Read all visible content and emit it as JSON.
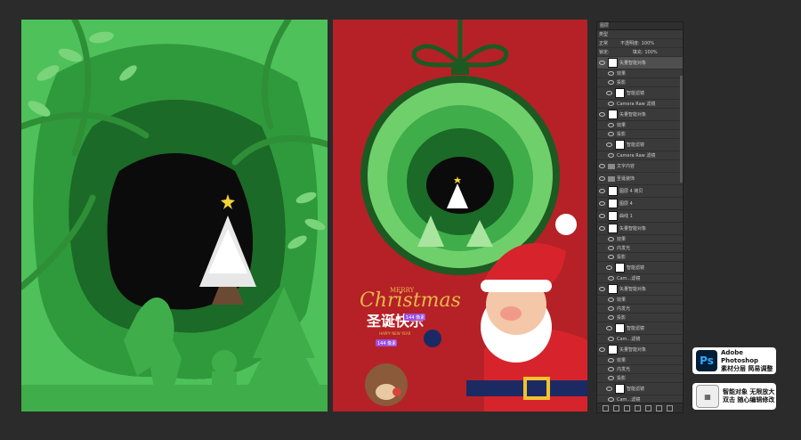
{
  "layers_panel": {
    "tab_label": "图层",
    "filter_kind": "类型",
    "blend_mode": "正常",
    "opacity_label": "不透明度:",
    "opacity_value": "100%",
    "lock_label": "锁定:",
    "fill_label": "填充:",
    "fill_value": "100%",
    "layers": [
      {
        "name": "矢量智能对象",
        "type": "layer",
        "selected": true
      },
      {
        "name": "效果",
        "type": "sub"
      },
      {
        "name": "投影",
        "type": "sub"
      },
      {
        "name": "智能滤镜",
        "type": "filter"
      },
      {
        "name": "Camera Raw 滤镜",
        "type": "sub"
      },
      {
        "name": "矢量智能对象",
        "type": "layer"
      },
      {
        "name": "效果",
        "type": "sub"
      },
      {
        "name": "投影",
        "type": "sub"
      },
      {
        "name": "智能滤镜",
        "type": "filter"
      },
      {
        "name": "Camera Raw 滤镜",
        "type": "sub"
      },
      {
        "name": "文字内容",
        "type": "group"
      },
      {
        "name": "圣诞装饰",
        "type": "group"
      },
      {
        "name": "图层 4 拷贝",
        "type": "layer"
      },
      {
        "name": "图层 4",
        "type": "layer"
      },
      {
        "name": "曲线 1",
        "type": "layer"
      },
      {
        "name": "矢量智能对象",
        "type": "layer"
      },
      {
        "name": "效果",
        "type": "sub"
      },
      {
        "name": "内发光",
        "type": "sub"
      },
      {
        "name": "投影",
        "type": "sub"
      },
      {
        "name": "智能滤镜",
        "type": "filter"
      },
      {
        "name": "Cam...滤镜",
        "type": "sub"
      },
      {
        "name": "矢量智能对象",
        "type": "layer"
      },
      {
        "name": "效果",
        "type": "sub"
      },
      {
        "name": "内发光",
        "type": "sub"
      },
      {
        "name": "投影",
        "type": "sub"
      },
      {
        "name": "智能滤镜",
        "type": "filter"
      },
      {
        "name": "Cam...滤镜",
        "type": "sub"
      },
      {
        "name": "矢量智能对象",
        "type": "layer"
      },
      {
        "name": "效果",
        "type": "sub"
      },
      {
        "name": "内发光",
        "type": "sub"
      },
      {
        "name": "投影",
        "type": "sub"
      },
      {
        "name": "智能滤镜",
        "type": "filter"
      },
      {
        "name": "Cam...滤镜",
        "type": "sub"
      }
    ]
  },
  "poster": {
    "merry": "MERRY",
    "christmas": "Christmas",
    "title_cn": "圣诞快乐",
    "tag1": "144 像素",
    "subtitle": "HAPPY NEW YEAR",
    "tag2": "144 像素"
  },
  "badges": {
    "photoshop_icon": "Ps",
    "photoshop_line1": "Adobe Photoshop",
    "photoshop_line2": "素材分层 简易调整",
    "smart_line1": "智能对象 无限放大",
    "smart_line2": "双击 随心编辑修改"
  },
  "colors": {
    "dark_green": "#0e3d16",
    "green": "#2f9a3c",
    "light_green": "#6fd06b",
    "red": "#b52127",
    "gold": "#e8b84a"
  }
}
